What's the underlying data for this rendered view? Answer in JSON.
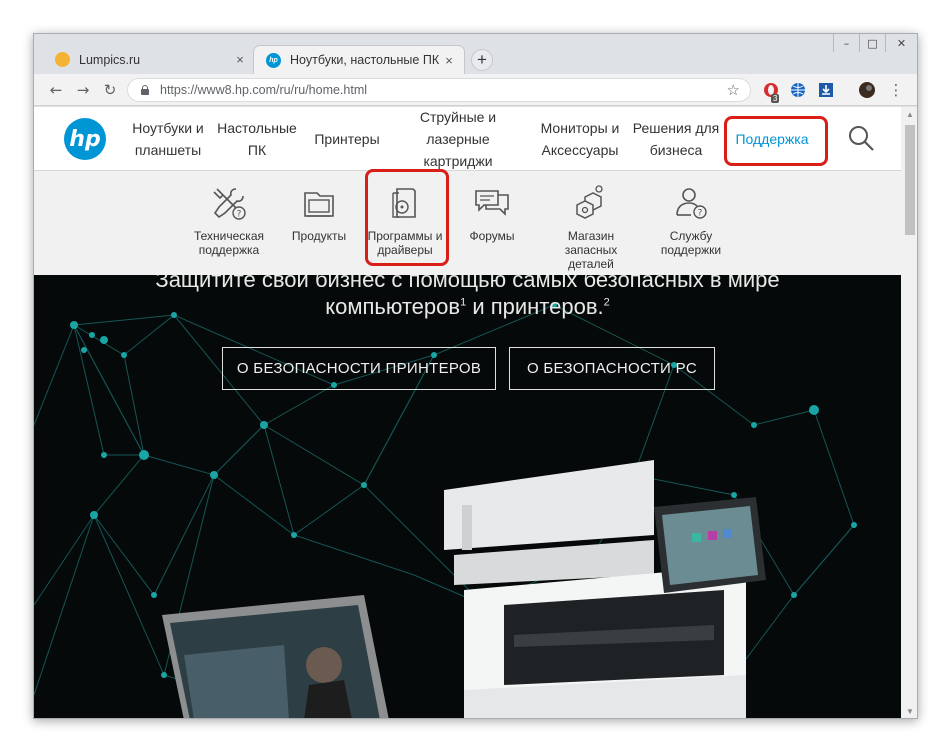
{
  "browser": {
    "tabs": [
      {
        "title": "Lumpics.ru",
        "close": "×"
      },
      {
        "title": "Ноутбуки, настольные ПК, прин",
        "close": "×",
        "favicon_text": "hp"
      }
    ],
    "new_tab": "+",
    "url": "https://www8.hp.com/ru/ru/home.html",
    "extension_badge": "3",
    "window_controls": {
      "minimize": "–",
      "maximize": "□",
      "close": "✕"
    }
  },
  "header": {
    "logo": "hp",
    "nav": [
      {
        "line1": "Ноутбуки и",
        "line2": "планшеты"
      },
      {
        "line1": "Настольные",
        "line2": "ПК"
      },
      {
        "line1": "Принтеры",
        "line2": ""
      },
      {
        "line1": "Струйные и",
        "line2": "лазерные картриджи"
      },
      {
        "line1": "Мониторы и",
        "line2": "Аксессуары"
      },
      {
        "line1": "Решения для",
        "line2": "бизнеса"
      },
      {
        "line1": "Поддержка",
        "line2": ""
      }
    ]
  },
  "subnav": [
    {
      "line1": "Техническая",
      "line2": "поддержка",
      "icon": "tools-icon"
    },
    {
      "line1": "Продукты",
      "line2": "",
      "icon": "products-icon"
    },
    {
      "line1": "Программы и",
      "line2": "драйверы",
      "icon": "software-icon"
    },
    {
      "line1": "Форумы",
      "line2": "",
      "icon": "forums-icon"
    },
    {
      "line1": "Магазин запасных",
      "line2": "деталей",
      "icon": "parts-icon"
    },
    {
      "line1": "Службу",
      "line2": "поддержки",
      "icon": "contact-icon"
    }
  ],
  "hero": {
    "line1": "Защитите свой бизнес с помощью самых безопасных в мире",
    "line2_a": "компьютеров",
    "sup1": "1",
    "line2_b": " и принтеров.",
    "sup2": "2",
    "button_printers": "О БЕЗОПАСНОСТИ ПРИНТЕРОВ",
    "button_pc": "О БЕЗОПАСНОСТИ PC"
  },
  "colors": {
    "hp_blue": "#0096d6",
    "highlight_red": "#d91e18",
    "hero_bg": "#050909",
    "node_teal": "#1aa5a5"
  }
}
